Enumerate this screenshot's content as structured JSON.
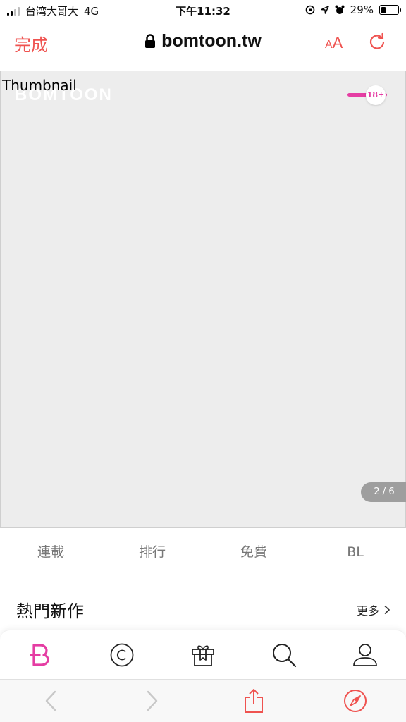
{
  "status_bar": {
    "carrier": "台湾大哥大",
    "network": "4G",
    "time": "下午11:32",
    "battery": "29%",
    "battery_level": 0.29
  },
  "browser": {
    "done_label": "完成",
    "url": "bomtoon.tw",
    "text_size_small": "A",
    "text_size_big": "A"
  },
  "banner": {
    "thumbnail_alt": "Thumbnail",
    "brand": "BOMTOON",
    "adult_toggle_label": "18+",
    "pager": "2 / 6"
  },
  "tabs": [
    {
      "label": "連載"
    },
    {
      "label": "排行"
    },
    {
      "label": "免費"
    },
    {
      "label": "BL"
    }
  ],
  "section": {
    "title": "熱門新作",
    "more_label": "更多"
  },
  "app_nav": [
    {
      "icon": "bomtoon-home-icon"
    },
    {
      "icon": "copyright-icon"
    },
    {
      "icon": "gift-icon"
    },
    {
      "icon": "search-icon"
    },
    {
      "icon": "user-icon"
    }
  ],
  "colors": {
    "accent": "#ef5350",
    "brand_pink": "#e53da3"
  }
}
